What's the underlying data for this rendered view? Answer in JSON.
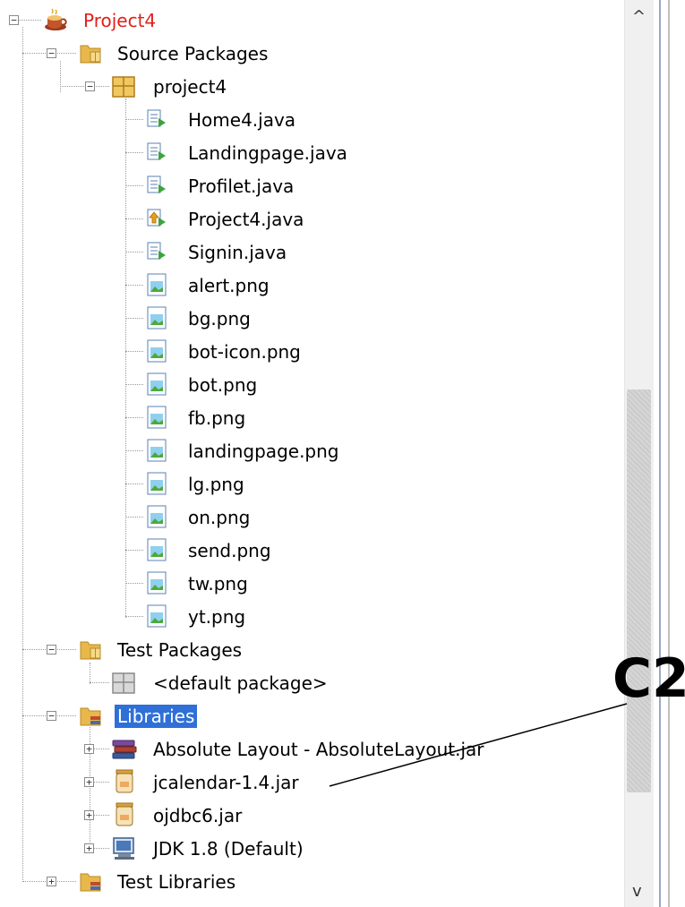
{
  "tree": {
    "root": {
      "label": "Project4",
      "icon": "coffee-cup-project-icon",
      "color": "#e0201c"
    },
    "source_packages": {
      "label": "Source Packages",
      "icon": "folder-package-icon"
    },
    "package": {
      "label": "project4",
      "icon": "package-icon"
    },
    "files": [
      {
        "label": "Home4.java",
        "icon": "java-form-icon"
      },
      {
        "label": "Landingpage.java",
        "icon": "java-form-icon"
      },
      {
        "label": "Profilet.java",
        "icon": "java-form-icon"
      },
      {
        "label": "Project4.java",
        "icon": "java-main-class-icon"
      },
      {
        "label": "Signin.java",
        "icon": "java-form-icon"
      },
      {
        "label": "alert.png",
        "icon": "image-file-icon"
      },
      {
        "label": "bg.png",
        "icon": "image-file-icon"
      },
      {
        "label": "bot-icon.png",
        "icon": "image-file-icon"
      },
      {
        "label": "bot.png",
        "icon": "image-file-icon"
      },
      {
        "label": "fb.png",
        "icon": "image-file-icon"
      },
      {
        "label": "landingpage.png",
        "icon": "image-file-icon"
      },
      {
        "label": "lg.png",
        "icon": "image-file-icon"
      },
      {
        "label": "on.png",
        "icon": "image-file-icon"
      },
      {
        "label": "send.png",
        "icon": "image-file-icon"
      },
      {
        "label": "tw.png",
        "icon": "image-file-icon"
      },
      {
        "label": "yt.png",
        "icon": "image-file-icon"
      }
    ],
    "test_packages": {
      "label": "Test Packages",
      "icon": "folder-package-icon"
    },
    "default_package": {
      "label": "<default package>",
      "icon": "package-gray-icon"
    },
    "libraries": {
      "label": "Libraries",
      "icon": "folder-library-icon",
      "selected": true,
      "selection_color": "#2f6fd8"
    },
    "library_items": [
      {
        "label": "Absolute Layout - AbsoluteLayout.jar",
        "icon": "library-books-icon"
      },
      {
        "label": "jcalendar-1.4.jar",
        "icon": "jar-file-icon"
      },
      {
        "label": "ojdbc6.jar",
        "icon": "jar-file-icon"
      },
      {
        "label": "JDK 1.8 (Default)",
        "icon": "jdk-monitor-icon"
      }
    ],
    "test_libraries": {
      "label": "Test Libraries",
      "icon": "folder-library-icon"
    }
  },
  "scrollbar": {
    "up_arrow": "^",
    "down_arrow": "v"
  },
  "annotation": {
    "label": "C2"
  }
}
